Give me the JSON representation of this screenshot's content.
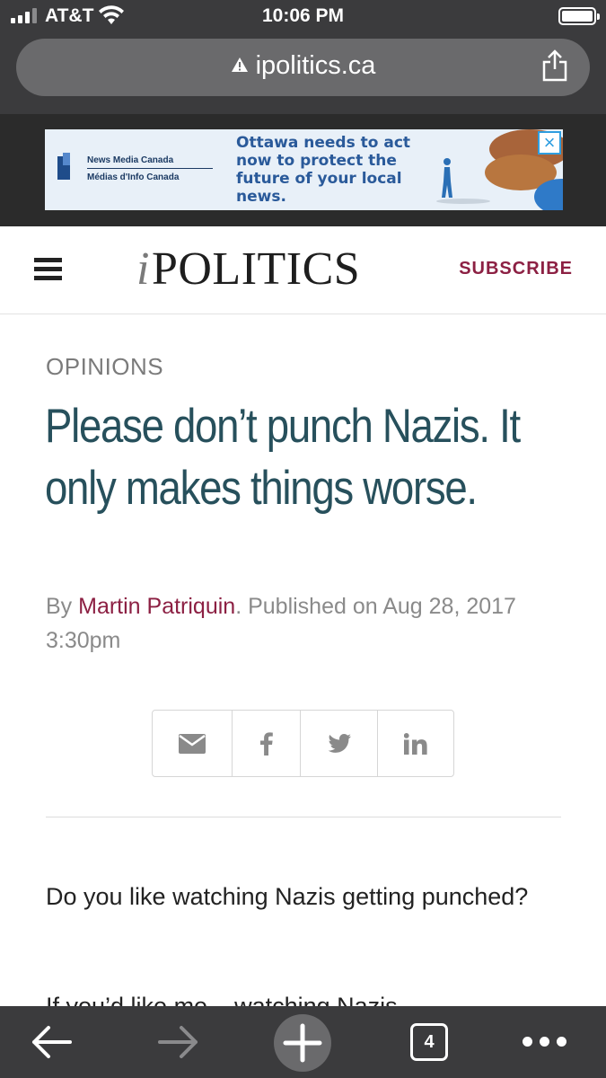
{
  "status_bar": {
    "carrier": "AT&T",
    "time": "10:06 PM"
  },
  "browser": {
    "url": "ipolitics.ca",
    "open_tabs": "4"
  },
  "ad": {
    "brand_en": "News Media Canada",
    "brand_fr": "Médias d'Info Canada",
    "headline": "Ottawa needs to act now to protect the future of your local news."
  },
  "site": {
    "logo_i": "i",
    "logo_rest": "POLITICS",
    "subscribe_label": "SUBSCRIBE"
  },
  "article": {
    "category": "OPINIONS",
    "title": "Please don’t punch Nazis. It only makes things worse.",
    "by_prefix": "By ",
    "author": "Martin Patriquin",
    "published": ". Published on Aug 28, 2017 3:30pm",
    "paragraph1": "Do you like watching Nazis getting punched?",
    "paragraph2_partial": "If you’d like me... watching Nazis"
  },
  "share_buttons": [
    "email-icon",
    "facebook-icon",
    "twitter-icon",
    "linkedin-icon"
  ],
  "colors": {
    "headline": "#27505c",
    "accent": "#8c2043",
    "chrome": "#3b3b3d"
  }
}
